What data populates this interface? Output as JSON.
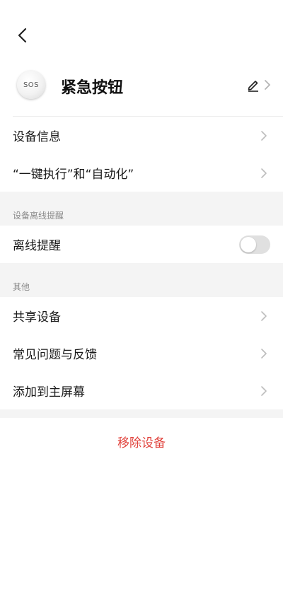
{
  "header": {
    "back_icon": "chevron-left-icon"
  },
  "device": {
    "avatar_text": "SOS",
    "name": "紧急按钮",
    "edit_icon": "pencil-icon"
  },
  "group1": {
    "items": [
      {
        "label": "设备信息"
      },
      {
        "label": "“一键执行”和“自动化”"
      }
    ]
  },
  "offline_section": {
    "header": "设备离线提醒",
    "item_label": "离线提醒",
    "toggle_on": false
  },
  "other_section": {
    "header": "其他",
    "items": [
      {
        "label": "共享设备"
      },
      {
        "label": "常见问题与反馈"
      },
      {
        "label": "添加到主屏幕"
      }
    ]
  },
  "remove": {
    "label": "移除设备"
  },
  "colors": {
    "danger": "#e0403a",
    "background": "#f4f4f4"
  }
}
